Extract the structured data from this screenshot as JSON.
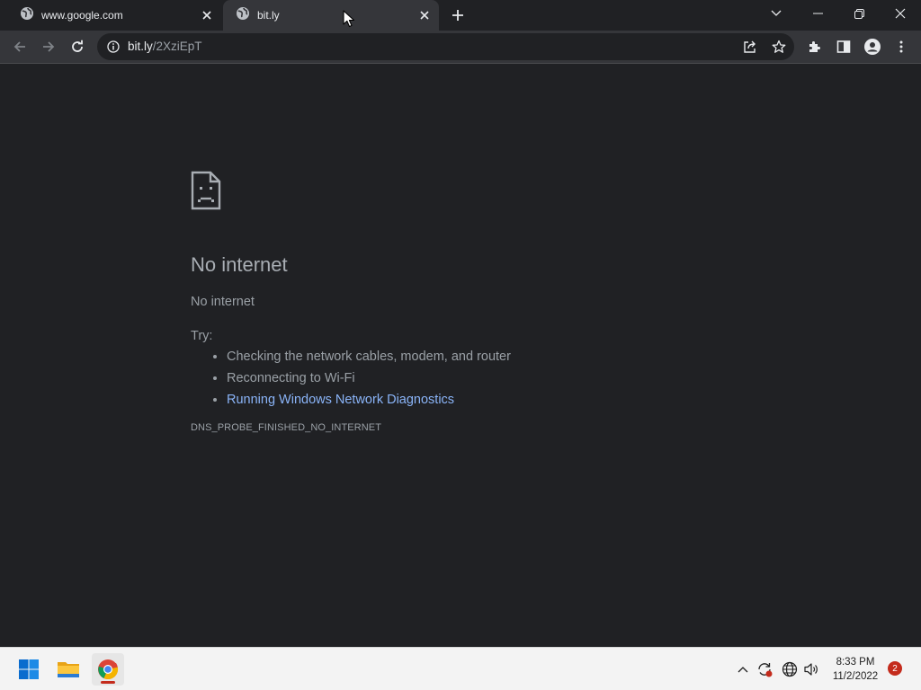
{
  "tabs": [
    {
      "title": "www.google.com",
      "icon": "globe-icon",
      "active": false
    },
    {
      "title": "bit.ly",
      "icon": "globe-icon",
      "active": true
    }
  ],
  "omnibox": {
    "host": "bit.ly",
    "path": "/2XziEpT"
  },
  "error": {
    "icon": "sad-page-icon",
    "heading": "No internet",
    "subtitle": "No internet",
    "try_label": "Try:",
    "suggestions": [
      "Checking the network cables, modem, and router",
      "Reconnecting to Wi-Fi",
      "Running Windows Network Diagnostics"
    ],
    "code": "DNS_PROBE_FINISHED_NO_INTERNET"
  },
  "taskbar": {
    "apps": [
      "windows-start-icon",
      "file-explorer-icon",
      "chrome-icon"
    ],
    "time": "8:33 PM",
    "date": "11/2/2022",
    "notification_count": "2"
  },
  "colors": {
    "link": "#8ab4f8",
    "background": "#202124",
    "toolbar": "#35363a"
  }
}
